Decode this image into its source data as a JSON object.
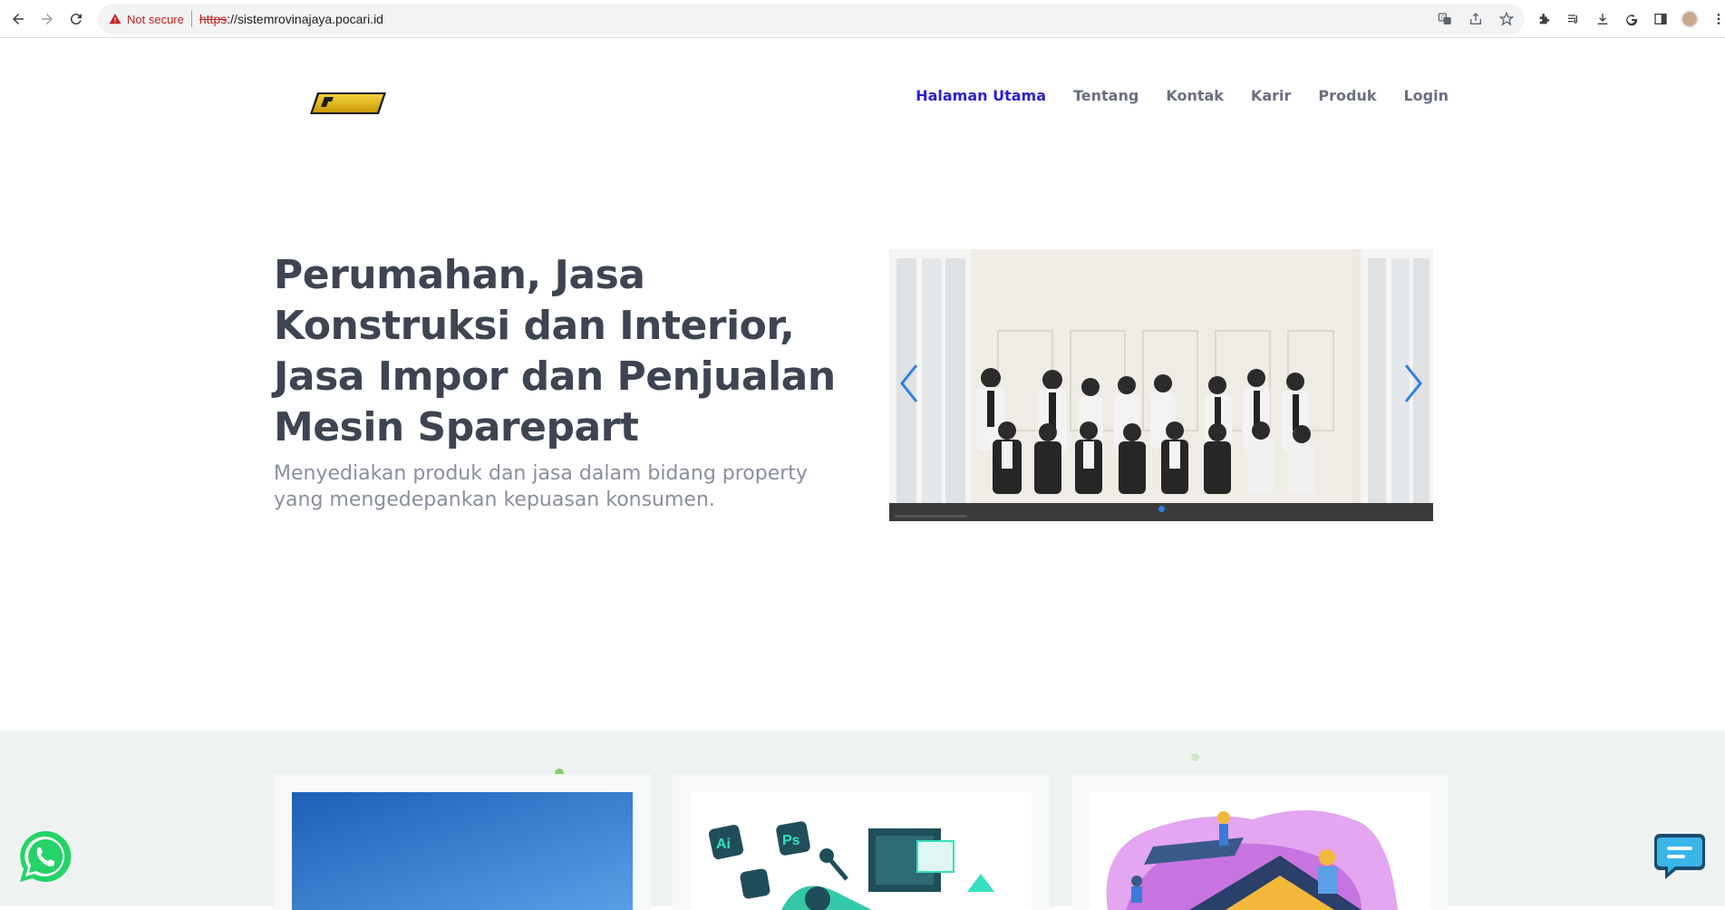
{
  "browser": {
    "security_label": "Not secure",
    "url_scheme": "https",
    "url_rest": "://sistemrovinajaya.pocari.id"
  },
  "site": {
    "logo_text": "RJS",
    "nav": [
      {
        "label": "Halaman Utama",
        "active": true
      },
      {
        "label": "Tentang",
        "active": false
      },
      {
        "label": "Kontak",
        "active": false
      },
      {
        "label": "Karir",
        "active": false
      },
      {
        "label": "Produk",
        "active": false
      },
      {
        "label": "Login",
        "active": false
      }
    ]
  },
  "hero": {
    "title": "Perumahan, Jasa Konstruksi dan Interior, Jasa Impor dan Penjualan Mesin Sparepart",
    "subtitle": "Menyediakan produk dan jasa dalam bidang property yang mengedepankan kepuasan konsumen."
  },
  "carousel": {
    "slide_count": 1,
    "active_index": 0,
    "prev_icon": "chevron-left-icon",
    "next_icon": "chevron-right-icon"
  },
  "features": {
    "cards": [
      {
        "name": "sky-image"
      },
      {
        "name": "design-apps-illustration",
        "labels": [
          "Ai",
          "Ps"
        ]
      },
      {
        "name": "construction-illustration"
      }
    ]
  },
  "colors": {
    "nav_active": "#2d1fd0",
    "nav": "#6a6f80",
    "hero_title": "#3f4452",
    "hero_sub": "#8a8f9c",
    "band": "#eef3f2",
    "whatsapp": "#25d366",
    "chat": "#3ab5e8"
  }
}
